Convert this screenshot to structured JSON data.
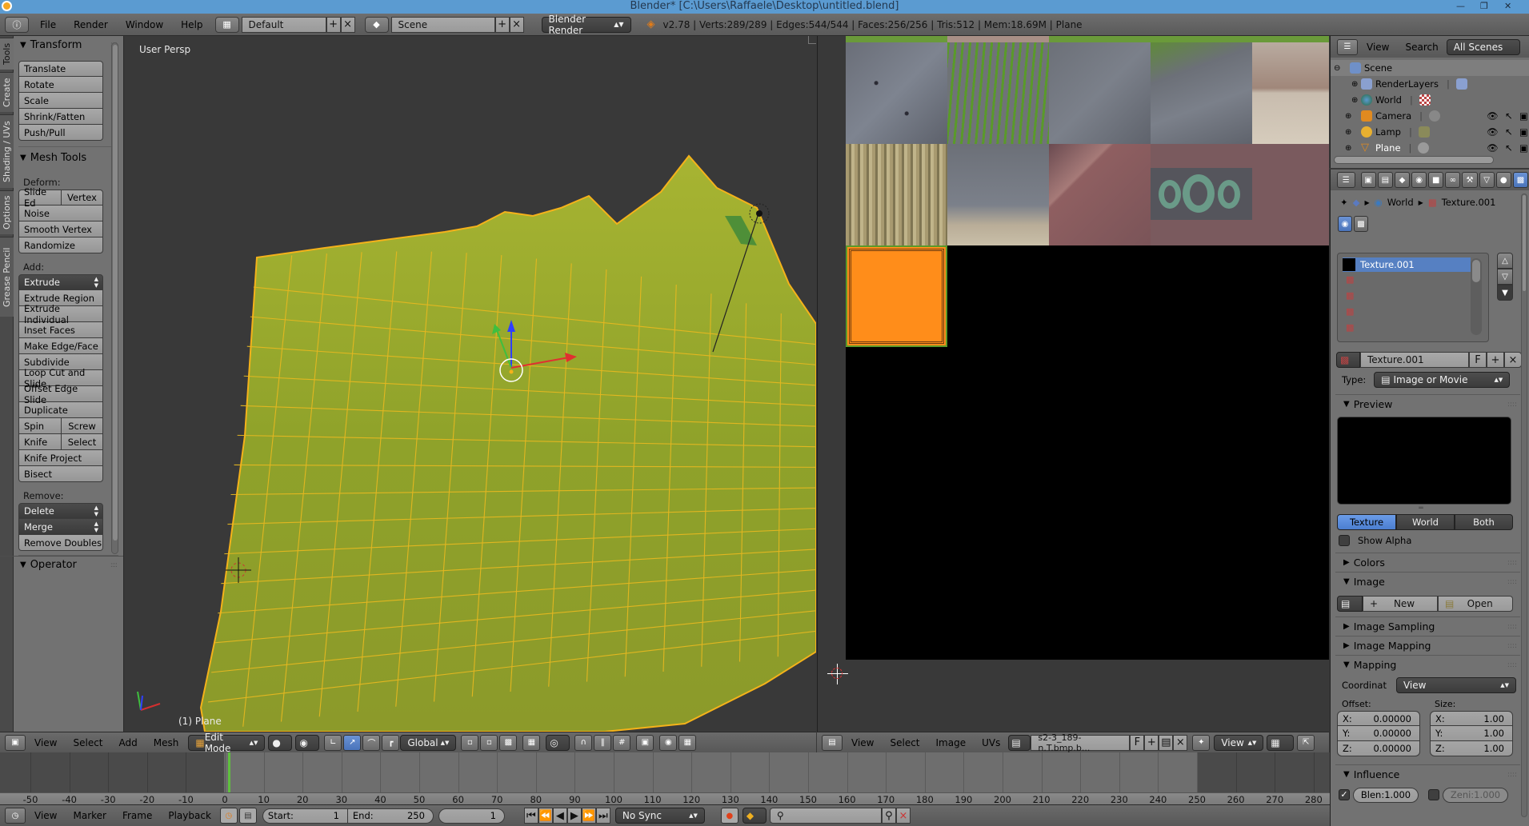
{
  "window": {
    "title": "Blender* [C:\\Users\\Raffaele\\Desktop\\untitled.blend]",
    "controls": [
      "minimize",
      "maximize",
      "close"
    ]
  },
  "topbar": {
    "menus": [
      "File",
      "Render",
      "Window",
      "Help"
    ],
    "layout": "Default",
    "scene": "Scene",
    "engine": "Blender Render",
    "stats": "v2.78 | Verts:289/289 | Edges:544/544 | Faces:256/256 | Tris:512 | Mem:18.69M | Plane"
  },
  "tool_tabs": [
    "Tools",
    "Create",
    "Shading / UVs",
    "Options",
    "Grease Pencil"
  ],
  "tool_shelf": {
    "transform": {
      "title": "Transform",
      "buttons": [
        "Translate",
        "Rotate",
        "Scale",
        "Shrink/Fatten",
        "Push/Pull"
      ]
    },
    "mesh_tools": {
      "title": "Mesh Tools",
      "deform_label": "Deform:",
      "deform_pair": [
        "Slide Ed",
        "Vertex"
      ],
      "deform_buttons": [
        "Noise",
        "Smooth Vertex",
        "Randomize"
      ],
      "add_label": "Add:",
      "extrude": "Extrude",
      "add_buttons": [
        "Extrude Region",
        "Extrude Individual",
        "Inset Faces",
        "Make Edge/Face",
        "Subdivide",
        "Loop Cut and Slide",
        "Offset Edge Slide",
        "Duplicate"
      ],
      "spin_pair": [
        "Spin",
        "Screw"
      ],
      "knife_pair": [
        "Knife",
        "Select"
      ],
      "add_buttons_2": [
        "Knife Project",
        "Bisect"
      ],
      "remove_label": "Remove:",
      "delete": "Delete",
      "merge": "Merge",
      "remove_doubles": "Remove Doubles"
    },
    "operator": {
      "title": "Operator"
    }
  },
  "viewport": {
    "view_label": "User Persp",
    "object_label": "(1) Plane",
    "header": {
      "menus": [
        "View",
        "Select",
        "Add",
        "Mesh"
      ],
      "mode": "Edit Mode",
      "orientation": "Global"
    }
  },
  "image_editor": {
    "header": {
      "menus": [
        "View",
        "Select",
        "Image",
        "UVs"
      ],
      "image_name": "s2-3_189-n.T.bmp.b...",
      "fake_user": "F",
      "view_mode": "View"
    }
  },
  "outliner": {
    "header": {
      "view": "View",
      "search": "Search",
      "filter": "All Scenes"
    },
    "items": [
      {
        "label": "Scene",
        "level": 0,
        "expanded": true
      },
      {
        "label": "RenderLayers",
        "level": 1
      },
      {
        "label": "World",
        "level": 1
      },
      {
        "label": "Camera",
        "level": 1,
        "visible": true
      },
      {
        "label": "Lamp",
        "level": 1,
        "visible": true
      },
      {
        "label": "Plane",
        "level": 1,
        "visible": true
      }
    ]
  },
  "properties": {
    "breadcrumb": [
      "World",
      "Texture.001"
    ],
    "texture_slots": [
      "Texture.001",
      "",
      "",
      "",
      ""
    ],
    "texture_name": "Texture.001",
    "fake_user": "F",
    "type_label": "Type:",
    "type_value": "Image or Movie",
    "preview": {
      "title": "Preview"
    },
    "preview_tabs": [
      "Texture",
      "World",
      "Both"
    ],
    "preview_active": "Texture",
    "show_alpha": {
      "label": "Show Alpha",
      "checked": false
    },
    "colors": {
      "title": "Colors"
    },
    "image": {
      "title": "Image",
      "new": "New",
      "open": "Open"
    },
    "image_sampling": {
      "title": "Image Sampling"
    },
    "image_mapping": {
      "title": "Image Mapping"
    },
    "mapping": {
      "title": "Mapping",
      "coord_label": "Coordinat",
      "coord_value": "View",
      "offset_label": "Offset:",
      "size_label": "Size:",
      "offset": [
        {
          "axis": "X:",
          "value": "0.00000"
        },
        {
          "axis": "Y:",
          "value": "0.00000"
        },
        {
          "axis": "Z:",
          "value": "0.00000"
        }
      ],
      "size": [
        {
          "axis": "X:",
          "value": "1.00"
        },
        {
          "axis": "Y:",
          "value": "1.00"
        },
        {
          "axis": "Z:",
          "value": "1.00"
        }
      ]
    },
    "influence": {
      "title": "Influence",
      "blend": {
        "label": "Blen:1.000",
        "checked": true
      },
      "zenith": {
        "label": "Zeni:1.000",
        "checked": false
      }
    }
  },
  "timeline": {
    "ticks": [
      -50,
      -40,
      -30,
      -20,
      -10,
      0,
      10,
      20,
      30,
      40,
      50,
      60,
      70,
      80,
      90,
      100,
      110,
      120,
      130,
      140,
      150,
      160,
      170,
      180,
      190,
      200,
      210,
      220,
      230,
      240,
      250,
      260,
      270,
      280
    ],
    "current_frame": 1,
    "header": {
      "menus": [
        "View",
        "Marker",
        "Frame",
        "Playback"
      ],
      "start_label": "Start:",
      "start": "1",
      "end_label": "End:",
      "end": "250",
      "frame": "1",
      "sync": "No Sync"
    }
  },
  "colors": {
    "title_bar": "#5b9bd1",
    "mesh_face": "#8fa22a",
    "mesh_edge": "#f5b21a",
    "selection_blue": "#5680c2",
    "frame_cursor": "#5fbf3f"
  }
}
